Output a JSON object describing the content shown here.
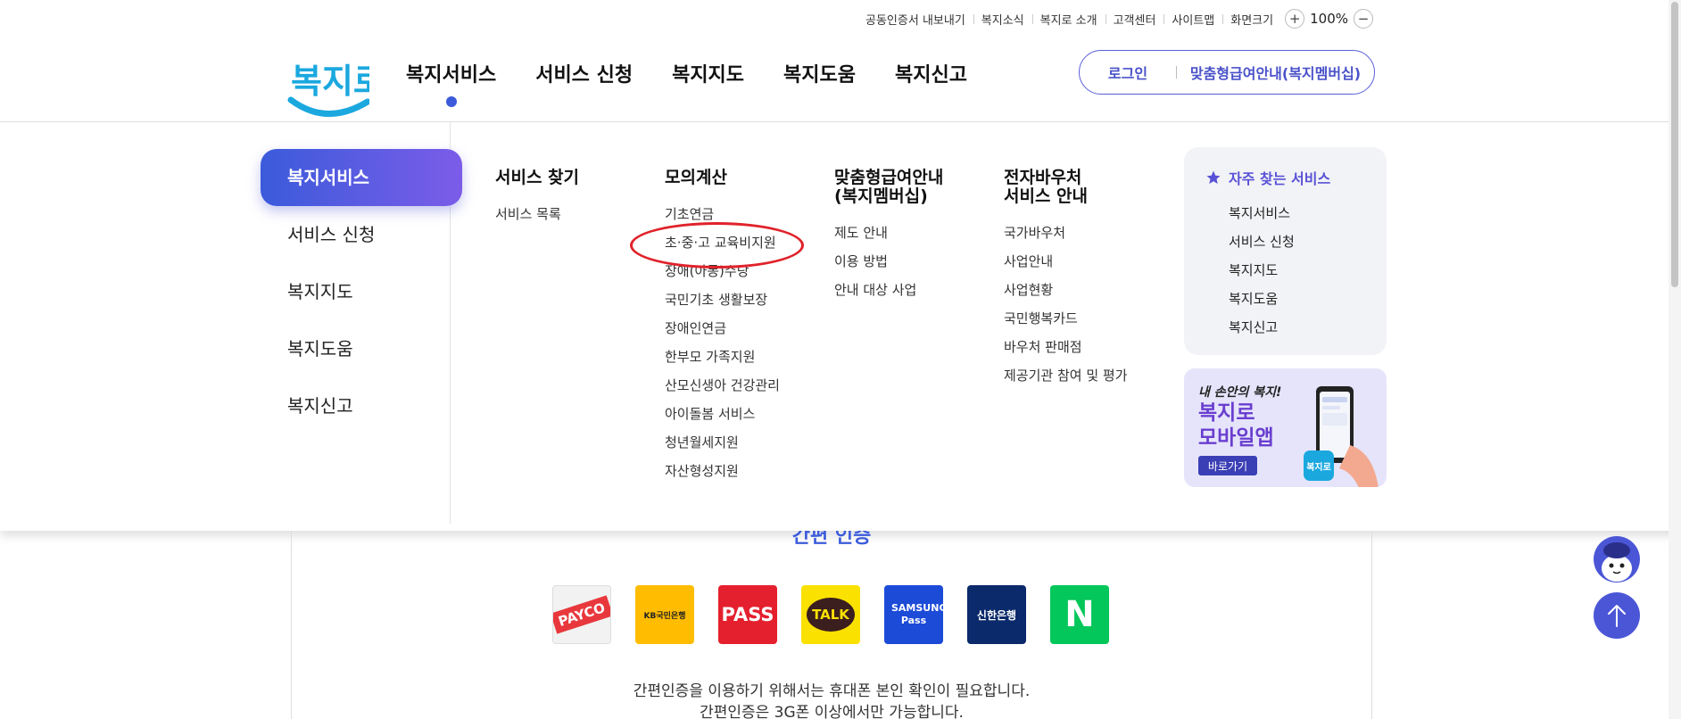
{
  "utility_bar": {
    "links": [
      "공동인증서 내보내기",
      "복지소식",
      "복지로 소개",
      "고객센터",
      "사이트맵",
      "화면크기"
    ],
    "zoom_in": "+",
    "zoom_value": "100%",
    "zoom_out": "−"
  },
  "header": {
    "logo_text": "복지로",
    "nav": [
      "복지서비스",
      "서비스 신청",
      "복지지도",
      "복지도움",
      "복지신고"
    ],
    "active_nav": "복지서비스",
    "login": "로그인",
    "membership": "맞춤형급여안내(복지멤버십)",
    "colors": {
      "brand": "#3b5bdb",
      "accent": "#5a5fd8"
    }
  },
  "mega_menu": {
    "side": [
      "복지서비스",
      "서비스 신청",
      "복지지도",
      "복지도움",
      "복지신고"
    ],
    "columns": [
      {
        "title": "서비스 찾기",
        "items": [
          "서비스 목록"
        ]
      },
      {
        "title": "모의계산",
        "items": [
          "기초연금",
          "초·중·고 교육비지원",
          "장애(아동)수당",
          "국민기초 생활보장",
          "장애인연금",
          "한부모 가족지원",
          "산모신생아 건강관리",
          "아이돌봄 서비스",
          "청년월세지원",
          "자산형성지원"
        ]
      },
      {
        "title": "맞춤형급여안내\n(복지멤버십)",
        "items": [
          "제도 안내",
          "이용 방법",
          "안내 대상 사업"
        ]
      },
      {
        "title": "전자바우처\n서비스 안내",
        "items": [
          "국가바우처",
          "사업안내",
          "사업현황",
          "국민행복카드",
          "바우처 판매점",
          "제공기관 참여 및 평가"
        ]
      }
    ],
    "favorites": {
      "title": "자주 찾는 서비스",
      "items": [
        "복지서비스",
        "서비스 신청",
        "복지지도",
        "복지도움",
        "복지신고"
      ]
    },
    "app_banner": {
      "subtitle": "내 손안의 복지!",
      "title": "복지로\n모바일앱",
      "button": "바로가기",
      "phone_badge": "복지로"
    }
  },
  "content": {
    "auth_title": "간편 인증",
    "auth_providers": [
      {
        "label": "PAYCO",
        "bg": "#f2f2f2",
        "fg": "#e8383d"
      },
      {
        "label": "KB국민은행",
        "bg": "#ffbc00",
        "fg": "#222222"
      },
      {
        "label": "PASS",
        "bg": "#e5202e",
        "fg": "#ffffff"
      },
      {
        "label": "TALK",
        "bg": "#fae100",
        "fg": "#3b1e1e"
      },
      {
        "label": "SAMSUNG Pass",
        "bg": "#1c4bd8",
        "fg": "#ffffff"
      },
      {
        "label": "신한은행",
        "bg": "#0b2a6b",
        "fg": "#ffffff"
      },
      {
        "label": "N",
        "bg": "#03c75a",
        "fg": "#ffffff"
      }
    ],
    "notes": [
      "간편인증을 이용하기 위해서는 휴대폰 본인 확인이 필요합니다.",
      "간편인증은 3G폰 이상에서만 가능합니다."
    ]
  }
}
